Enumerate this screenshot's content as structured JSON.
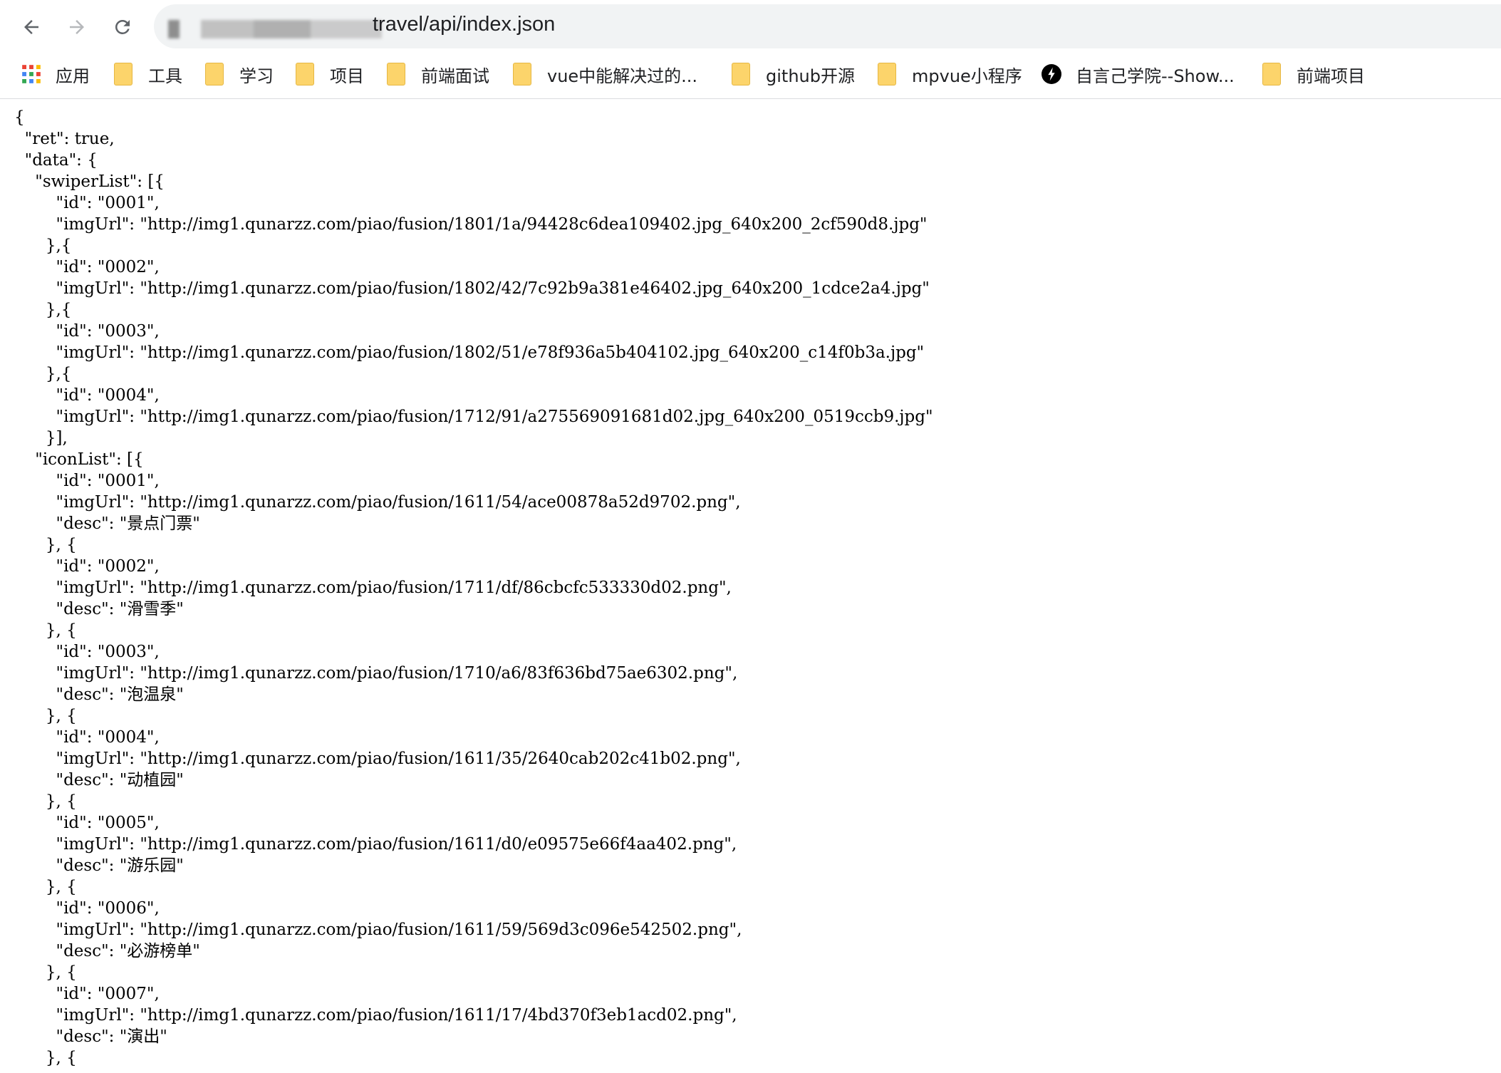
{
  "browser": {
    "address": {
      "url_visible": "travel/api/index.json"
    },
    "bookmarks": [
      {
        "label": "应用",
        "icon": "apps-grid-icon"
      },
      {
        "label": "工具",
        "icon": "folder-icon"
      },
      {
        "label": "学习",
        "icon": "folder-icon"
      },
      {
        "label": "项目",
        "icon": "folder-icon"
      },
      {
        "label": "前端面试",
        "icon": "folder-icon"
      },
      {
        "label": "vue中能解决过的...",
        "icon": "folder-icon"
      },
      {
        "label": "github开源",
        "icon": "folder-icon"
      },
      {
        "label": "mpvue小程序",
        "icon": "folder-icon"
      },
      {
        "label": "自言己学院--Show...",
        "icon": "site-logo-icon"
      },
      {
        "label": "前端项目",
        "icon": "folder-icon"
      }
    ]
  },
  "content": {
    "json_text": "{\n  \"ret\": true,\n  \"data\": {\n    \"swiperList\": [{\n        \"id\": \"0001\",\n        \"imgUrl\": \"http://img1.qunarzz.com/piao/fusion/1801/1a/94428c6dea109402.jpg_640x200_2cf590d8.jpg\"\n      },{\n        \"id\": \"0002\",\n        \"imgUrl\": \"http://img1.qunarzz.com/piao/fusion/1802/42/7c92b9a381e46402.jpg_640x200_1cdce2a4.jpg\"\n      },{\n        \"id\": \"0003\",\n        \"imgUrl\": \"http://img1.qunarzz.com/piao/fusion/1802/51/e78f936a5b404102.jpg_640x200_c14f0b3a.jpg\"\n      },{\n        \"id\": \"0004\",\n        \"imgUrl\": \"http://img1.qunarzz.com/piao/fusion/1712/91/a275569091681d02.jpg_640x200_0519ccb9.jpg\"\n      }],\n    \"iconList\": [{\n        \"id\": \"0001\",\n        \"imgUrl\": \"http://img1.qunarzz.com/piao/fusion/1611/54/ace00878a52d9702.png\",\n        \"desc\": \"景点门票\"\n      }, {\n        \"id\": \"0002\",\n        \"imgUrl\": \"http://img1.qunarzz.com/piao/fusion/1711/df/86cbcfc533330d02.png\",\n        \"desc\": \"滑雪季\"\n      }, {\n        \"id\": \"0003\",\n        \"imgUrl\": \"http://img1.qunarzz.com/piao/fusion/1710/a6/83f636bd75ae6302.png\",\n        \"desc\": \"泡温泉\"\n      }, {\n        \"id\": \"0004\",\n        \"imgUrl\": \"http://img1.qunarzz.com/piao/fusion/1611/35/2640cab202c41b02.png\",\n        \"desc\": \"动植园\"\n      }, {\n        \"id\": \"0005\",\n        \"imgUrl\": \"http://img1.qunarzz.com/piao/fusion/1611/d0/e09575e66f4aa402.png\",\n        \"desc\": \"游乐园\"\n      }, {\n        \"id\": \"0006\",\n        \"imgUrl\": \"http://img1.qunarzz.com/piao/fusion/1611/59/569d3c096e542502.png\",\n        \"desc\": \"必游榜单\"\n      }, {\n        \"id\": \"0007\",\n        \"imgUrl\": \"http://img1.qunarzz.com/piao/fusion/1611/17/4bd370f3eb1acd02.png\",\n        \"desc\": \"演出\"\n      }, {"
  }
}
